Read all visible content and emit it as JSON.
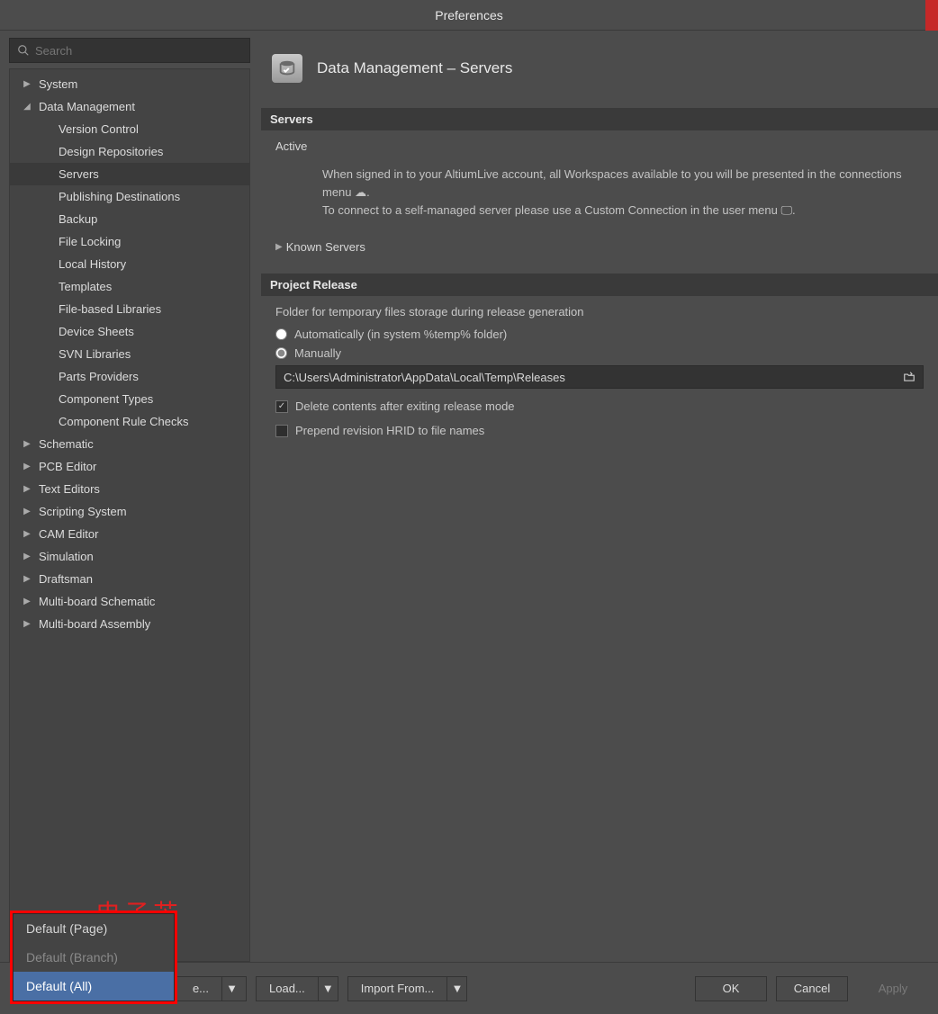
{
  "window": {
    "title": "Preferences"
  },
  "search": {
    "placeholder": "Search"
  },
  "tree": {
    "items": [
      {
        "label": "System",
        "expanded": false,
        "children": []
      },
      {
        "label": "Data Management",
        "expanded": true,
        "children": [
          {
            "label": "Version Control"
          },
          {
            "label": "Design Repositories"
          },
          {
            "label": "Servers",
            "selected": true
          },
          {
            "label": "Publishing Destinations"
          },
          {
            "label": "Backup"
          },
          {
            "label": "File Locking"
          },
          {
            "label": "Local History"
          },
          {
            "label": "Templates"
          },
          {
            "label": "File-based Libraries"
          },
          {
            "label": "Device Sheets"
          },
          {
            "label": "SVN Libraries"
          },
          {
            "label": "Parts Providers"
          },
          {
            "label": "Component Types"
          },
          {
            "label": "Component Rule Checks"
          }
        ]
      },
      {
        "label": "Schematic",
        "expanded": false,
        "children": []
      },
      {
        "label": "PCB Editor",
        "expanded": false,
        "children": []
      },
      {
        "label": "Text Editors",
        "expanded": false,
        "children": []
      },
      {
        "label": "Scripting System",
        "expanded": false,
        "children": []
      },
      {
        "label": "CAM Editor",
        "expanded": false,
        "children": []
      },
      {
        "label": "Simulation",
        "expanded": false,
        "children": []
      },
      {
        "label": "Draftsman",
        "expanded": false,
        "children": []
      },
      {
        "label": "Multi-board Schematic",
        "expanded": false,
        "children": []
      },
      {
        "label": "Multi-board Assembly",
        "expanded": false,
        "children": []
      }
    ]
  },
  "page": {
    "title": "Data Management – Servers",
    "servers": {
      "header": "Servers",
      "active_label": "Active",
      "desc1a": "When signed in to your AltiumLive account, all Workspaces available to you will be presented in the connections menu ",
      "desc1b": ".",
      "desc2": "To connect to a self-managed server please use a Custom Connection in the user menu 🖵.",
      "known_label": "Known Servers"
    },
    "release": {
      "header": "Project Release",
      "folder_label": "Folder for temporary files storage during release generation",
      "opt_auto": "Automatically (in system %temp% folder)",
      "opt_manual": "Manually",
      "path": "C:\\Users\\Administrator\\AppData\\Local\\Temp\\Releases",
      "chk_delete": "Delete contents after exiting release mode",
      "chk_prepend": "Prepend revision HRID to file names"
    }
  },
  "watermark": "电子芯",
  "default_menu": {
    "page": "Default (Page)",
    "branch": "Default (Branch)",
    "all": "Default (All)"
  },
  "footer": {
    "set_defaults_trunc": "e...",
    "load": "Load...",
    "import": "Import From...",
    "ok": "OK",
    "cancel": "Cancel",
    "apply": "Apply"
  }
}
